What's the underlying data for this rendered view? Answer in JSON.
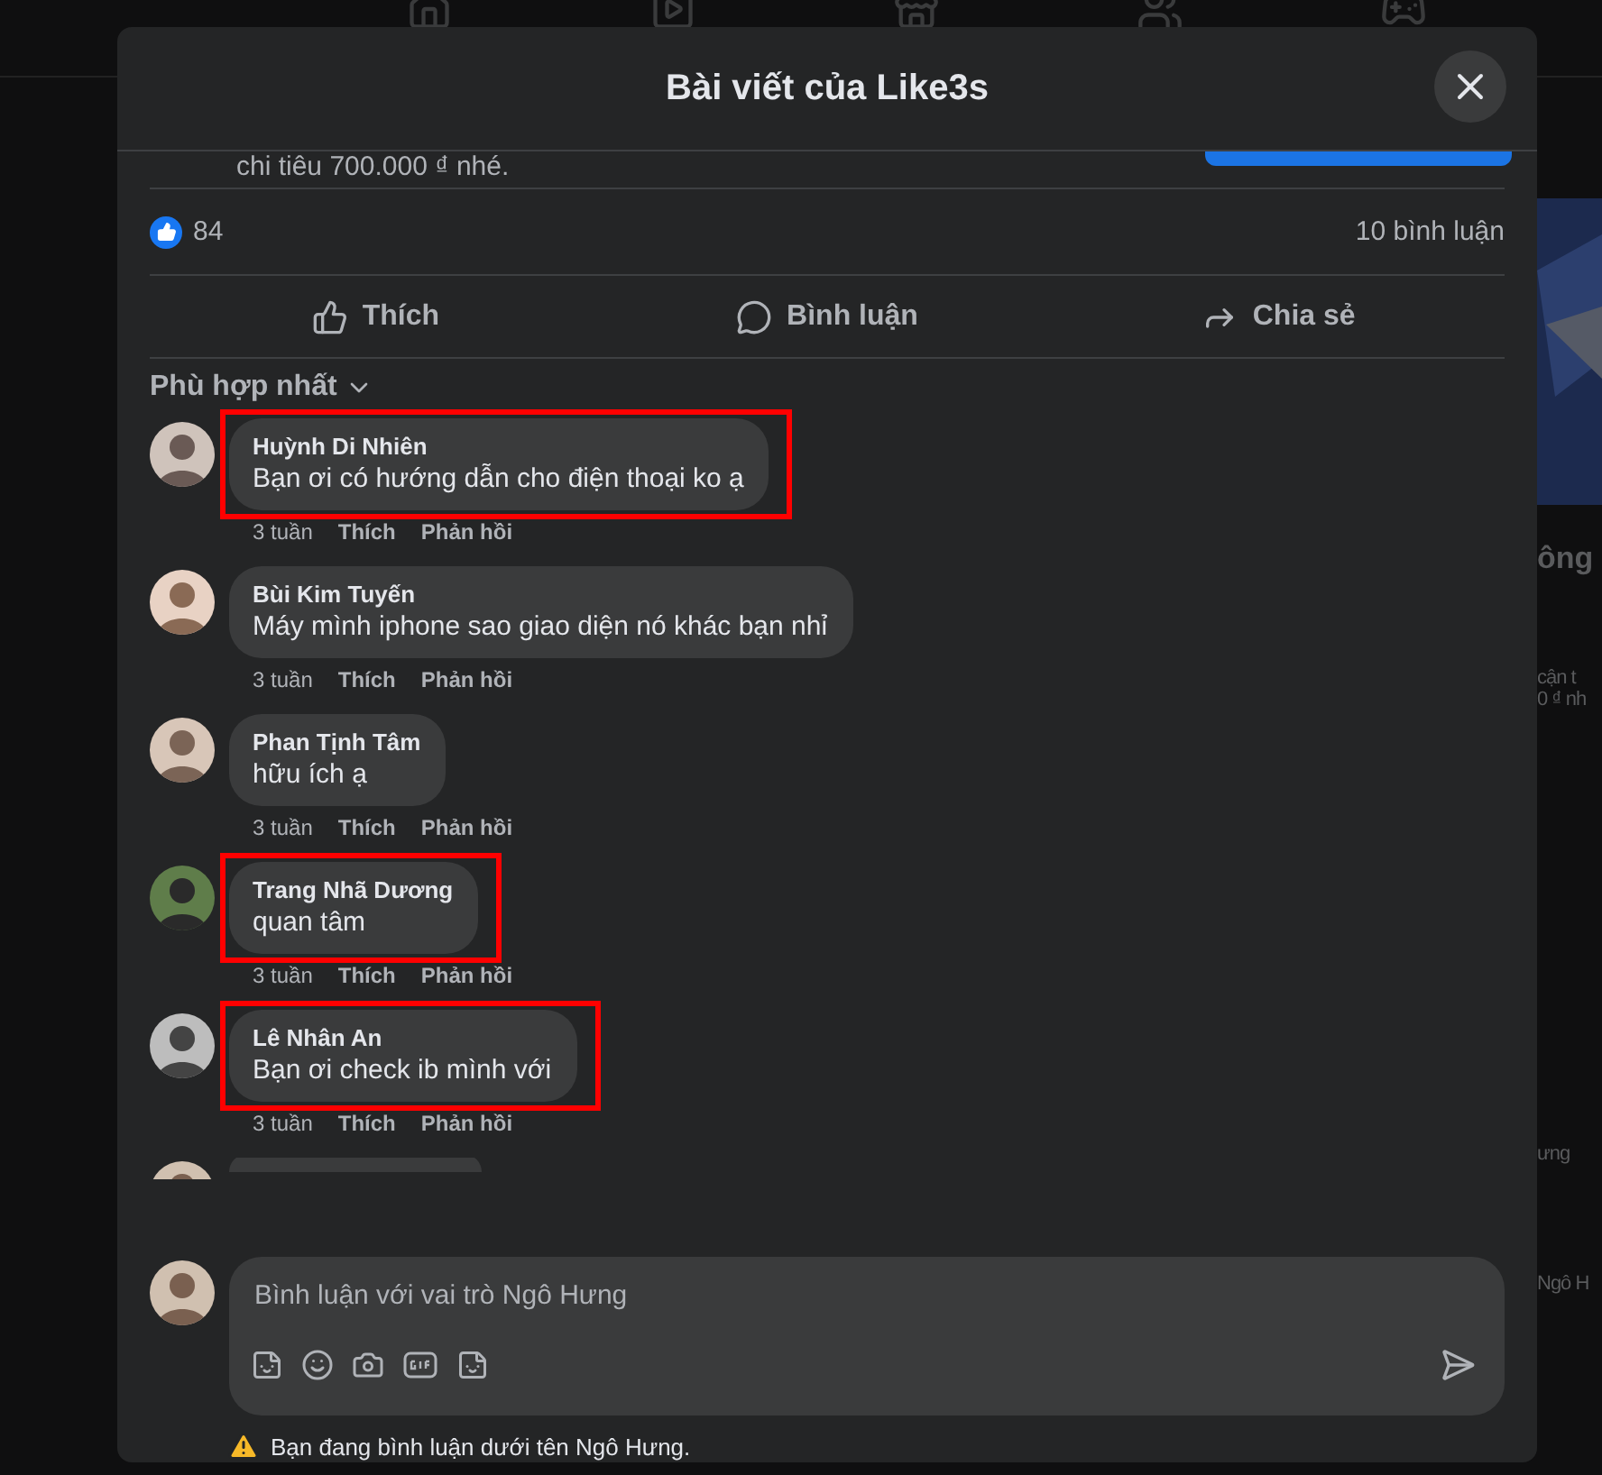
{
  "background_page": {
    "side_texts": [
      {
        "text": "ông",
        "kind": "heading"
      },
      {
        "text": "cận t",
        "kind": "body"
      },
      {
        "text": "0 ₫ nh",
        "kind": "body"
      },
      {
        "text": "ưng",
        "kind": "body"
      },
      {
        "text": "Ngô H",
        "kind": "body"
      }
    ]
  },
  "dialog": {
    "title": "Bài viết của Like3s",
    "post_snippet": "chi tiêu 700.000 ₫ nhé.",
    "reactions": {
      "count": "84",
      "comments": "10 bình luận"
    },
    "actions": [
      {
        "label": "Thích",
        "kind": "like"
      },
      {
        "label": "Bình luận",
        "kind": "comment"
      },
      {
        "label": "Chia sẻ",
        "kind": "share"
      }
    ],
    "sort": "Phù hợp nhất",
    "comments": [
      {
        "name": "Huỳnh Di Nhiên",
        "text": "Bạn ơi có hướng dẫn cho điện thoại ko ạ",
        "time": "3 tuần",
        "like": "Thích",
        "reply": "Phản hồi",
        "highlighted": true
      },
      {
        "name": "Bùi Kim Tuyến",
        "text": "Máy mình iphone sao giao diện nó khác bạn nhỉ",
        "time": "3 tuần",
        "like": "Thích",
        "reply": "Phản hồi",
        "highlighted": false
      },
      {
        "name": "Phan Tịnh Tâm",
        "text": "hữu ích ạ",
        "time": "3 tuần",
        "like": "Thích",
        "reply": "Phản hồi",
        "highlighted": false
      },
      {
        "name": "Trang Nhã Dương",
        "text": "quan tâm",
        "time": "3 tuần",
        "like": "Thích",
        "reply": "Phản hồi",
        "highlighted": true
      },
      {
        "name": "Lê Nhân An",
        "text": "Bạn ơi check ib mình với",
        "time": "3 tuần",
        "like": "Thích",
        "reply": "Phản hồi",
        "highlighted": true
      }
    ],
    "composer": {
      "placeholder": "Bình luận với vai trò Ngô Hưng",
      "notice": "Bạn đang bình luận dưới tên Ngô Hưng."
    }
  }
}
